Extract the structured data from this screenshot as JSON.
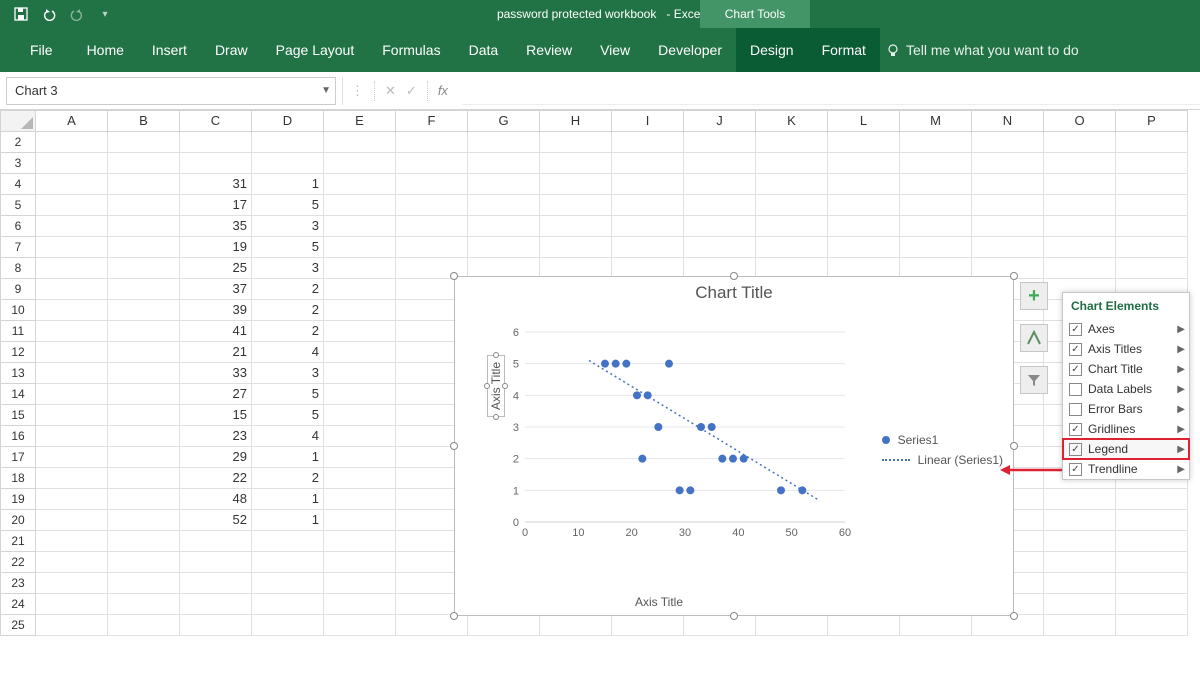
{
  "app": {
    "doc_title": "password protected workbook",
    "suffix": "- Excel",
    "chart_tools": "Chart Tools"
  },
  "ribbon": {
    "tabs": [
      "File",
      "Home",
      "Insert",
      "Draw",
      "Page Layout",
      "Formulas",
      "Data",
      "Review",
      "View",
      "Developer"
    ],
    "ctx_tabs": [
      "Design",
      "Format"
    ],
    "tellme": "Tell me what you want to do"
  },
  "namebox": "Chart 3",
  "fx_label": "fx",
  "columns": [
    "A",
    "B",
    "C",
    "D",
    "E",
    "F",
    "G",
    "H",
    "I",
    "J",
    "K",
    "L",
    "M",
    "N",
    "O",
    "P"
  ],
  "row_start": 2,
  "row_end": 25,
  "cells_C": {
    "4": 31,
    "5": 17,
    "6": 35,
    "7": 19,
    "8": 25,
    "9": 37,
    "10": 39,
    "11": 41,
    "12": 21,
    "13": 33,
    "14": 27,
    "15": 15,
    "16": 23,
    "17": 29,
    "18": 22,
    "19": 48,
    "20": 52
  },
  "cells_D": {
    "4": 1,
    "5": 5,
    "6": 3,
    "7": 5,
    "8": 3,
    "9": 2,
    "10": 2,
    "11": 2,
    "12": 4,
    "13": 3,
    "14": 5,
    "15": 5,
    "16": 4,
    "17": 1,
    "18": 2,
    "19": 1,
    "20": 1
  },
  "chart_elements_flyout": {
    "title": "Chart Elements",
    "items": [
      {
        "label": "Axes",
        "checked": true
      },
      {
        "label": "Axis Titles",
        "checked": true
      },
      {
        "label": "Chart Title",
        "checked": true
      },
      {
        "label": "Data Labels",
        "checked": false
      },
      {
        "label": "Error Bars",
        "checked": false
      },
      {
        "label": "Gridlines",
        "checked": true
      },
      {
        "label": "Legend",
        "checked": true,
        "highlight": true
      },
      {
        "label": "Trendline",
        "checked": true
      }
    ]
  },
  "chart_data": {
    "type": "scatter",
    "title": "Chart Title",
    "xlabel": "Axis Title",
    "ylabel": "Axis Title",
    "xlim": [
      0,
      60
    ],
    "ylim": [
      0,
      6
    ],
    "x_ticks": [
      0,
      10,
      20,
      30,
      40,
      50,
      60
    ],
    "y_ticks": [
      0,
      1,
      2,
      3,
      4,
      5,
      6
    ],
    "series": [
      {
        "name": "Series1",
        "x": [
          31,
          17,
          35,
          19,
          25,
          37,
          39,
          41,
          21,
          33,
          27,
          15,
          23,
          29,
          22,
          48,
          52
        ],
        "y": [
          1,
          5,
          3,
          5,
          3,
          2,
          2,
          2,
          4,
          3,
          5,
          5,
          4,
          1,
          2,
          1,
          1
        ]
      }
    ],
    "trendline": {
      "name": "Linear (Series1)",
      "x0": 12,
      "y0": 5.1,
      "x1": 55,
      "y1": 0.7
    },
    "legend_entries": [
      "Series1",
      "Linear (Series1)"
    ]
  }
}
